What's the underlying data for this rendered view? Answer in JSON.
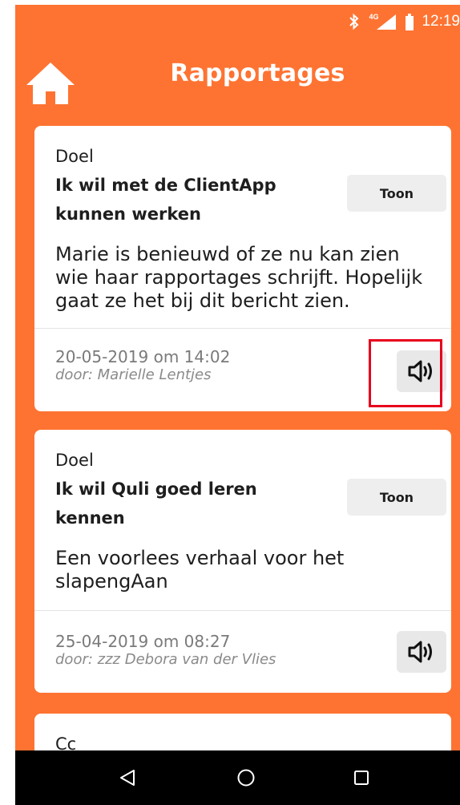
{
  "status_bar": {
    "network_label": "4G",
    "time": "12:19",
    "icons": [
      "bluetooth-icon",
      "signal-icon",
      "battery-icon"
    ]
  },
  "header": {
    "title": "Rapportages",
    "home_icon": "home-icon"
  },
  "reports": [
    {
      "label": "Doel",
      "goal": "Ik wil met de ClientApp kunnen werken",
      "toon_label": "Toon",
      "message": "Marie is benieuwd of ze nu kan zien wie haar rapportages schrijft. Hopelijk gaat ze het bij dit bericht zien.",
      "date": "20-05-2019 om 14:02",
      "author": "door: Marielle Lentjes",
      "speaker_icon": "speaker-icon"
    },
    {
      "label": "Doel",
      "goal": "Ik wil Quli goed leren kennen",
      "toon_label": "Toon",
      "message": "Een voorlees verhaal voor het slapengAan",
      "date": "25-04-2019 om 08:27",
      "author": "door: zzz Debora van der Vlies",
      "speaker_icon": "speaker-icon"
    },
    {
      "label": "Cc"
    }
  ],
  "nav_bar": {
    "icons": [
      "back-triangle-icon",
      "home-circle-icon",
      "recents-square-icon"
    ]
  },
  "colors": {
    "brand_orange": "#fe7332",
    "highlight_red": "#e8001c",
    "card_bg": "#ffffff",
    "button_grey": "#eeeeee"
  }
}
